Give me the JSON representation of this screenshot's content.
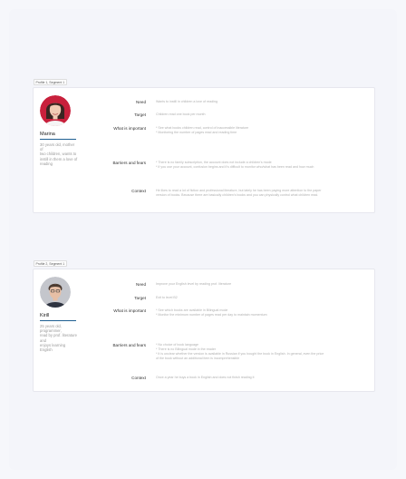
{
  "profiles": [
    {
      "tag": "Profile 1, Segment 1",
      "name": "Marina",
      "bio": [
        "30 years old, mother of",
        "two children, wants to",
        "instill in them a love of",
        "reading"
      ],
      "rows": [
        {
          "label": "Need",
          "lines": [
            "Wants to instill in children a love of reading"
          ]
        },
        {
          "label": "Target",
          "lines": [
            "Children read one book per month"
          ]
        },
        {
          "label": "What is important",
          "lines": [
            "* See what books children read, control of inaccessible literature",
            "* Monitoring the number of pages read and reading time"
          ]
        },
        {
          "label": "Barriers and fears",
          "lines": [
            "* There is no family subscription, the account does not include a children's mode",
            "* If you use your account, confusion begins and it's difficult to monitor who/what has been read and how much"
          ]
        },
        {
          "label": "Context",
          "lines": [
            "He likes to read a lot of fiction and professional literature, but lately he has been paying more attention to the paper",
            "version of books. Because there are basically children's books and you can physically control what children read."
          ]
        }
      ]
    },
    {
      "tag": "Profile 2, Segment 1",
      "name": "Kirill",
      "bio": [
        "25 years old, programmer,",
        "read by prof. literature and",
        "enjoys learning English"
      ],
      "rows": [
        {
          "label": "Need",
          "lines": [
            "Improve your English level by reading prof. literature"
          ]
        },
        {
          "label": "Target",
          "lines": [
            "Exit to level B2"
          ]
        },
        {
          "label": "What is important",
          "lines": [
            "* See which books are available in Bilingual mode",
            "* Monitor the minimum number of pages read per day to maintain momentum"
          ]
        },
        {
          "label": "Barriers and fears",
          "lines": [
            "* No choice of book language",
            "* There is no Bilingual mode in the reader",
            "* It is unclear whether the version is available in Russian if you bought the book in English. In general, even the price",
            "  of the book without an additional item is incomprehensible"
          ]
        },
        {
          "label": "Context",
          "lines": [
            "Once a year he buys a book in English and does not finish reading it"
          ]
        }
      ]
    }
  ]
}
